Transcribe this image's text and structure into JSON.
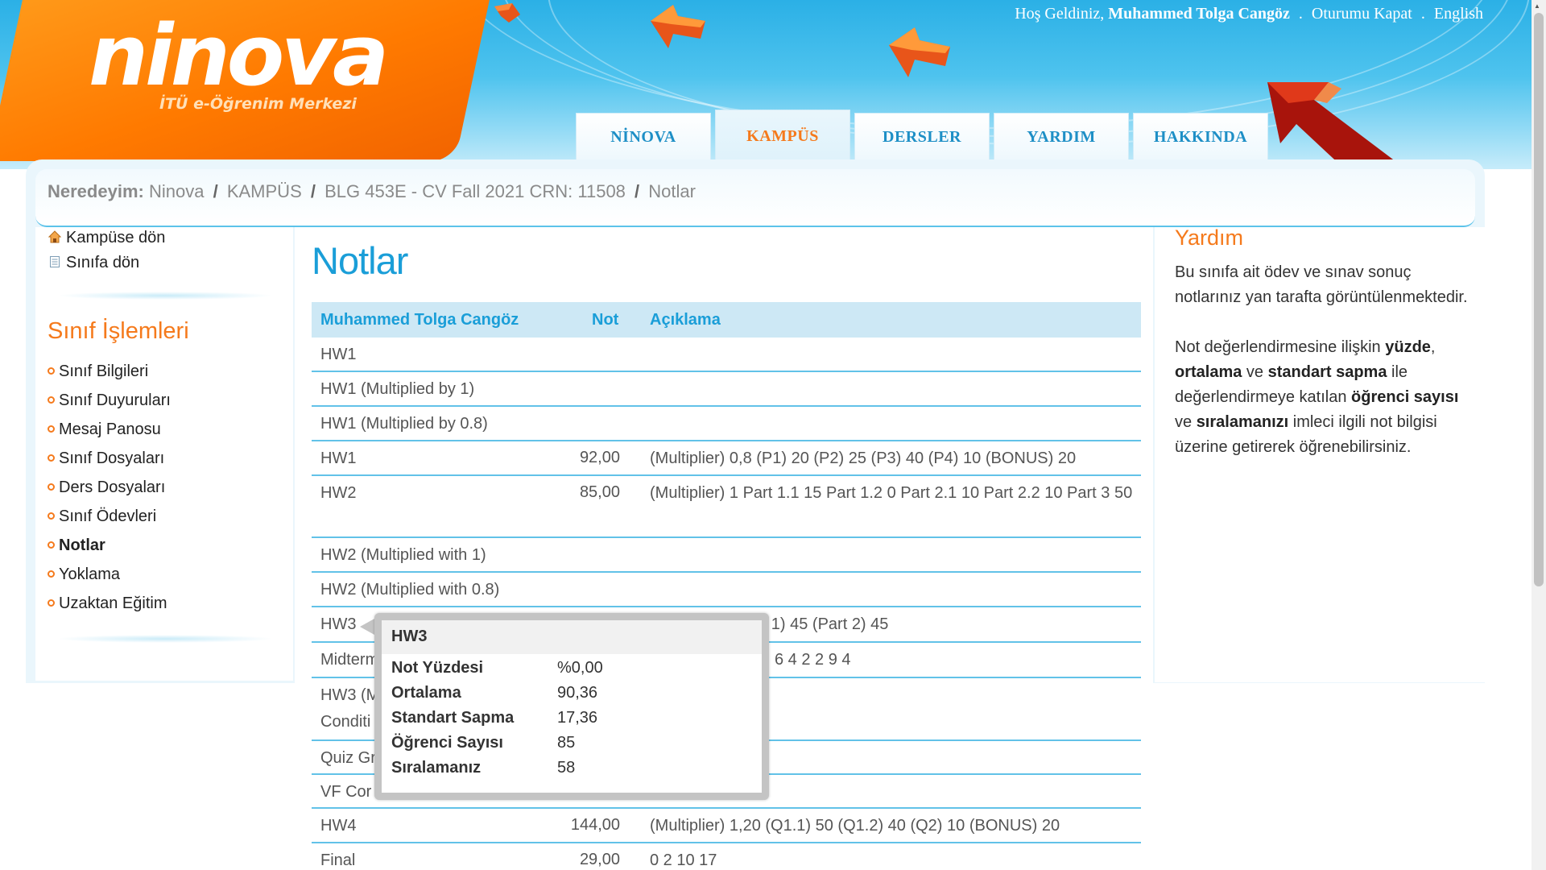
{
  "header": {
    "logo": "ninova",
    "logo_subtitle": "İTÜ e-Öğrenim Merkezi",
    "welcome_prefix": "Hoş Geldiniz,",
    "user_name": "Muhammed Tolga Cangöz",
    "sep": ".",
    "logout": "Oturumu Kapat",
    "language": "English"
  },
  "nav": {
    "tabs": [
      {
        "label": "NİNOVA"
      },
      {
        "label": "KAMPÜS"
      },
      {
        "label": "DERSLER"
      },
      {
        "label": "YARDIM"
      },
      {
        "label": "HAKKINDA"
      }
    ],
    "active": "KAMPÜS"
  },
  "breadcrumb": {
    "label": "Neredeyim:",
    "sep": "/",
    "items": [
      "Ninova",
      "KAMPÜS",
      "BLG 453E - CV Fall 2021 CRN: 11508",
      "Notlar"
    ]
  },
  "sidebar": {
    "back_campus": "Kampüse dön",
    "back_class": "Sınıfa dön",
    "title": "Sınıf İşlemleri",
    "items": [
      {
        "label": "Sınıf Bilgileri"
      },
      {
        "label": "Sınıf Duyuruları"
      },
      {
        "label": "Mesaj Panosu"
      },
      {
        "label": "Sınıf Dosyaları"
      },
      {
        "label": "Ders Dosyaları"
      },
      {
        "label": "Sınıf Ödevleri"
      },
      {
        "label": "Notlar"
      },
      {
        "label": "Yoklama"
      },
      {
        "label": "Uzaktan Eğitim"
      }
    ],
    "active": "Notlar"
  },
  "main": {
    "title": "Notlar",
    "columns": {
      "name": "Muhammed Tolga Cangöz",
      "grade": "Not",
      "desc": "Açıklama"
    },
    "rows": [
      {
        "name": "HW1",
        "grade": "",
        "desc": ""
      },
      {
        "name": "HW1 (Multiplied by 1)",
        "grade": "",
        "desc": ""
      },
      {
        "name": "HW1 (Multiplied by 0.8)",
        "grade": "",
        "desc": ""
      },
      {
        "name": "HW1",
        "grade": "92,00",
        "desc": "(Multiplier) 0,8 (P1) 20 (P2) 25 (P3) 40 (P4) 10 (BONUS) 20"
      },
      {
        "name": "HW2",
        "grade": "85,00",
        "desc": "(Multiplier) 1 Part 1.1 15 Part 1.2 0 Part 2.1 10 Part 2.2 10 Part 3 50"
      },
      {
        "name": "HW2 (Multiplied with 1)",
        "grade": "",
        "desc": ""
      },
      {
        "name": "HW2 (Multiplied with 0.8)",
        "grade": "",
        "desc": ""
      },
      {
        "name": "HW3",
        "grade": "",
        "desc": "rt 1) 45 (Part 2) 45"
      },
      {
        "name": "Midterm",
        "grade": "",
        "desc": "6 4 2 2 9 4"
      },
      {
        "name": "HW3 (M",
        "name2": "Conditi",
        "grade": "",
        "desc": ""
      },
      {
        "name": "Quiz Gr",
        "grade": "",
        "desc": ""
      },
      {
        "name": "VF Cor",
        "grade": "",
        "desc": ""
      },
      {
        "name": "HW4",
        "grade": "144,00",
        "desc": "(Multiplier) 1,20 (Q1.1) 50 (Q1.2) 40 (Q2) 10 (BONUS) 20"
      },
      {
        "name": "Final",
        "grade": "29,00",
        "desc": "0 2 10 17"
      }
    ]
  },
  "tooltip": {
    "title": "HW3",
    "rows": [
      {
        "key": "Not Yüzdesi",
        "value": "%0,00"
      },
      {
        "key": "Ortalama",
        "value": "90,36"
      },
      {
        "key": "Standart Sapma",
        "value": "17,36"
      },
      {
        "key": "Öğrenci Sayısı",
        "value": "85"
      },
      {
        "key": "Sıralamanız",
        "value": "58"
      }
    ]
  },
  "help": {
    "title": "Yardım",
    "p1": "Bu sınıfa ait ödev ve sınav sonuç notlarınız yan tarafta görüntülenmektedir.",
    "p2_a": "Not değerlendirmesine ilişkin ",
    "p2_b": "yüzde",
    "p2_c": ", ",
    "p2_d": "ortalama",
    "p2_e": " ve ",
    "p2_f": "standart sapma",
    "p2_g": " ile değerlendirmeye katılan ",
    "p2_h": "öğrenci sayısı",
    "p2_i": " ve ",
    "p2_j": "sıralamanızı",
    "p2_k": " imleci ilgili not bilgisi üzerine getirerek öğrenebilirsiniz."
  },
  "colors": {
    "accent_orange": "#f57a1c",
    "accent_blue": "#1a9ed8",
    "header_blue": "#2bb0e6"
  }
}
